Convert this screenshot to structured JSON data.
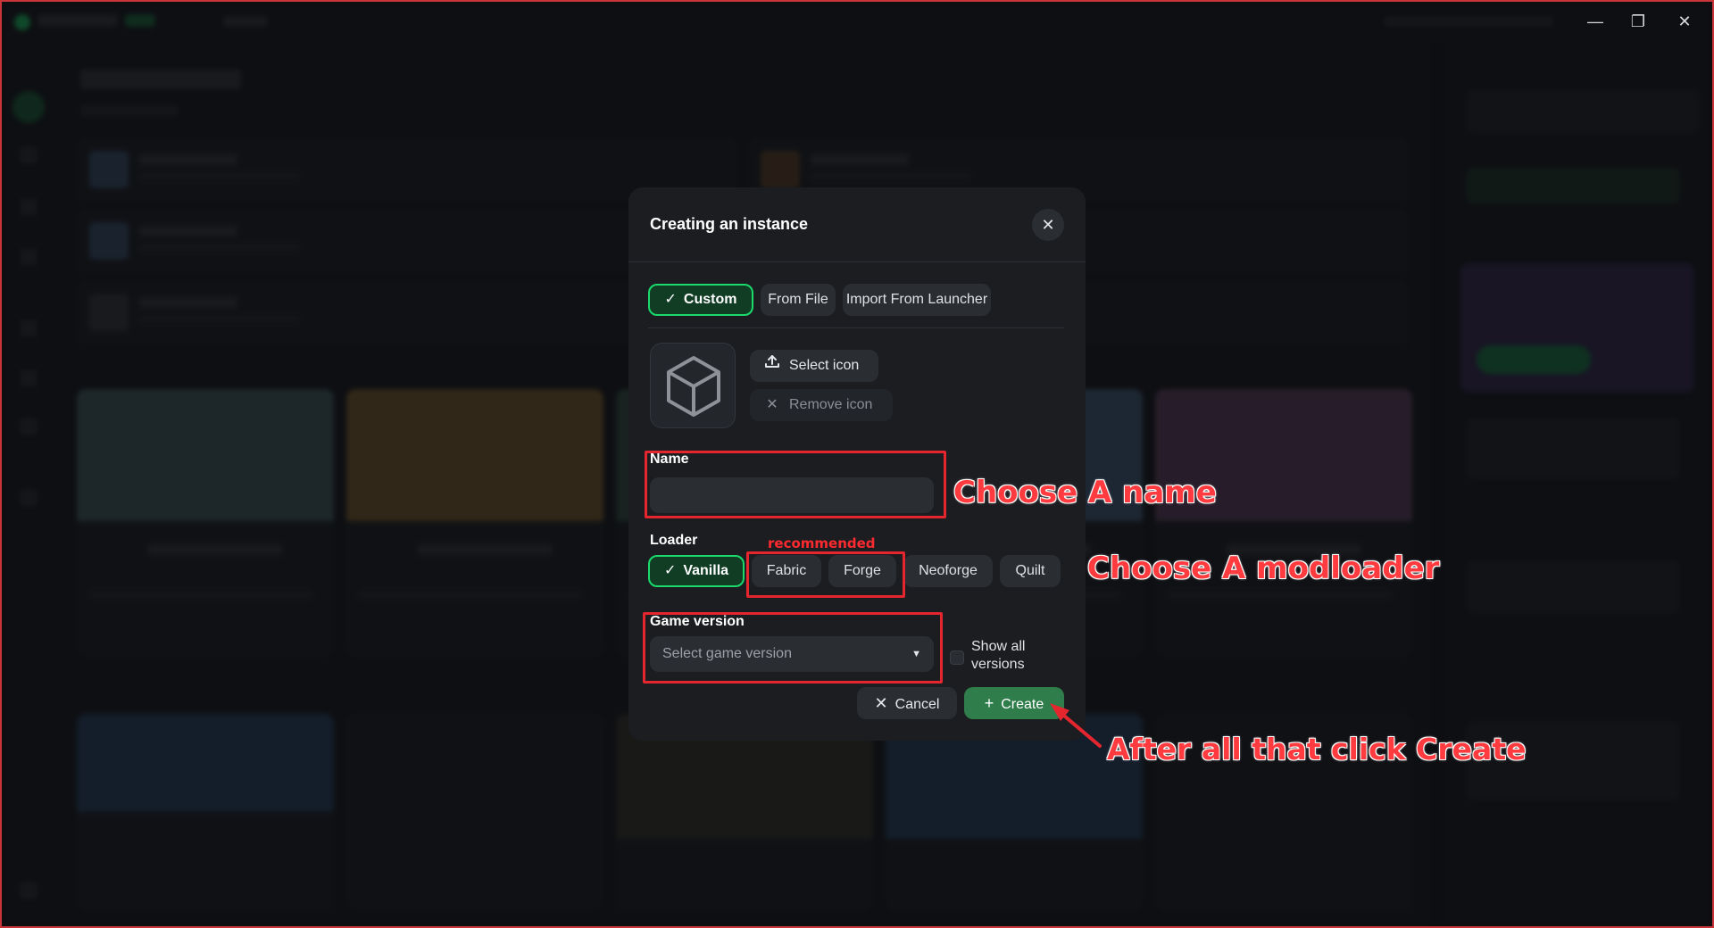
{
  "modal": {
    "title": "Creating an instance",
    "tabs": [
      {
        "label": "Custom",
        "active": true
      },
      {
        "label": "From File",
        "active": false
      },
      {
        "label": "Import From Launcher",
        "active": false
      }
    ],
    "select_icon_label": "Select icon",
    "remove_icon_label": "Remove icon",
    "name_label": "Name",
    "name_value": "",
    "loader_label": "Loader",
    "loaders": [
      {
        "label": "Vanilla",
        "active": true
      },
      {
        "label": "Fabric",
        "active": false
      },
      {
        "label": "Forge",
        "active": false
      },
      {
        "label": "Neoforge",
        "active": false
      },
      {
        "label": "Quilt",
        "active": false
      }
    ],
    "game_version_label": "Game version",
    "game_version_placeholder": "Select game version",
    "show_all_versions_label": "Show all versions",
    "show_all_versions_checked": false,
    "cancel_label": "Cancel",
    "create_label": "Create"
  },
  "annotations": {
    "recommended": "recommended",
    "choose_name": "Choose A name",
    "choose_modloader": "Choose A modloader",
    "click_create": "After all that click Create"
  },
  "icons": {
    "check": "check-icon",
    "close": "close-icon",
    "upload": "upload-icon",
    "remove": "x-icon",
    "cube": "cube-icon",
    "caret": "chevron-down-icon",
    "plus": "plus-icon"
  },
  "colors": {
    "accent_green": "#1bd96a",
    "create_green": "#2f7d4a",
    "annotation_red": "#e5262f"
  }
}
